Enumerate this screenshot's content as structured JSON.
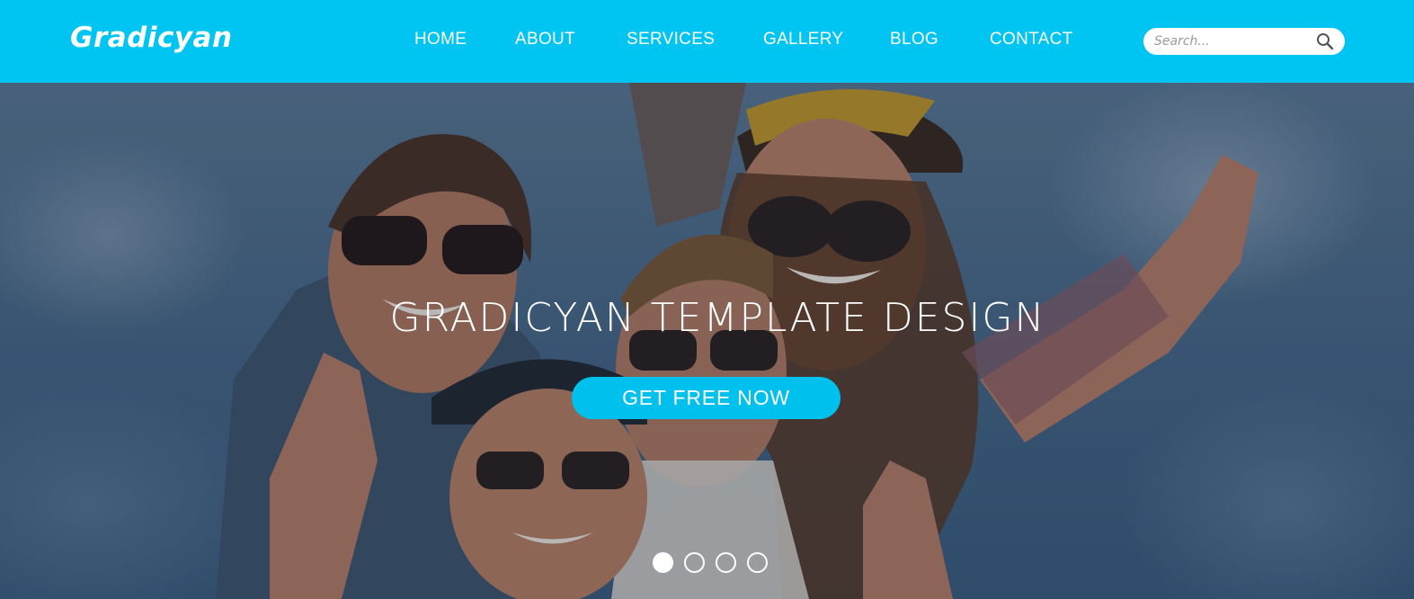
{
  "header": {
    "logo": "Gradicyan",
    "nav": [
      {
        "label": "HOME"
      },
      {
        "label": "ABOUT"
      },
      {
        "label": "SERVICES"
      },
      {
        "label": "GALLERY"
      },
      {
        "label": "BLOG"
      },
      {
        "label": "CONTACT"
      }
    ],
    "search": {
      "placeholder": "Search...",
      "value": "",
      "icon": "search-icon"
    }
  },
  "hero": {
    "title": "GRADICYAN TEMPLATE DESIGN",
    "cta_label": "GET FREE NOW",
    "slides": {
      "count": 4,
      "active_index": 0
    }
  },
  "colors": {
    "brand": "#00c4f1",
    "button": "#00c0ee",
    "text": "#ffffff"
  }
}
